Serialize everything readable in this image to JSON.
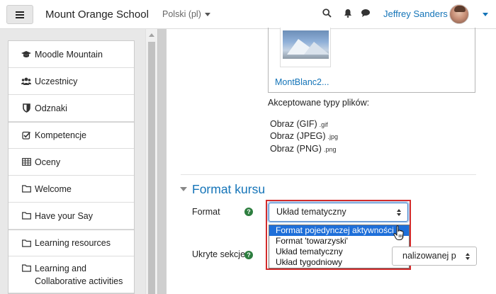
{
  "navbar": {
    "site_name": "Mount Orange School",
    "language": "Polski (pl)",
    "user_name": "Jeffrey Sanders",
    "accent_color": "#1474b8"
  },
  "sidebar": {
    "items": [
      {
        "label": "Moodle Mountain",
        "icon": "graduation-cap-icon"
      },
      {
        "label": "Uczestnicy",
        "icon": "users-icon"
      },
      {
        "label": "Odznaki",
        "icon": "shield-icon"
      },
      {
        "label": "Kompetencje",
        "icon": "checkbox-icon"
      },
      {
        "label": "Oceny",
        "icon": "table-icon"
      },
      {
        "label": "Welcome",
        "icon": "folder-icon"
      },
      {
        "label": "Have your Say",
        "icon": "folder-icon"
      },
      {
        "label": "Learning resources",
        "icon": "folder-icon"
      },
      {
        "label": "Learning and Collaborative activities",
        "icon": "folder-icon"
      }
    ]
  },
  "main": {
    "file": {
      "name": "MontBlanc2..."
    },
    "accepted_types_label": "Akceptowane typy plików:",
    "accepted_types": [
      {
        "label": "Obraz (GIF)",
        "ext": ".gif"
      },
      {
        "label": "Obraz (JPEG)",
        "ext": ".jpg"
      },
      {
        "label": "Obraz (PNG)",
        "ext": ".png"
      }
    ],
    "section_title": "Format kursu",
    "format_label": "Format",
    "format_select": {
      "value": "Układ tematyczny",
      "options": [
        "Format pojedynczej aktywności",
        "Format 'towarzyski'",
        "Układ tematyczny",
        "Układ tygodniowy"
      ],
      "highlighted": "Format pojedynczej aktywności"
    },
    "hidden_sections_label": "Ukryte sekcje",
    "hidden_sections_select": {
      "value": "nalizowanej p"
    },
    "highlight_color": "#d32c2c"
  }
}
